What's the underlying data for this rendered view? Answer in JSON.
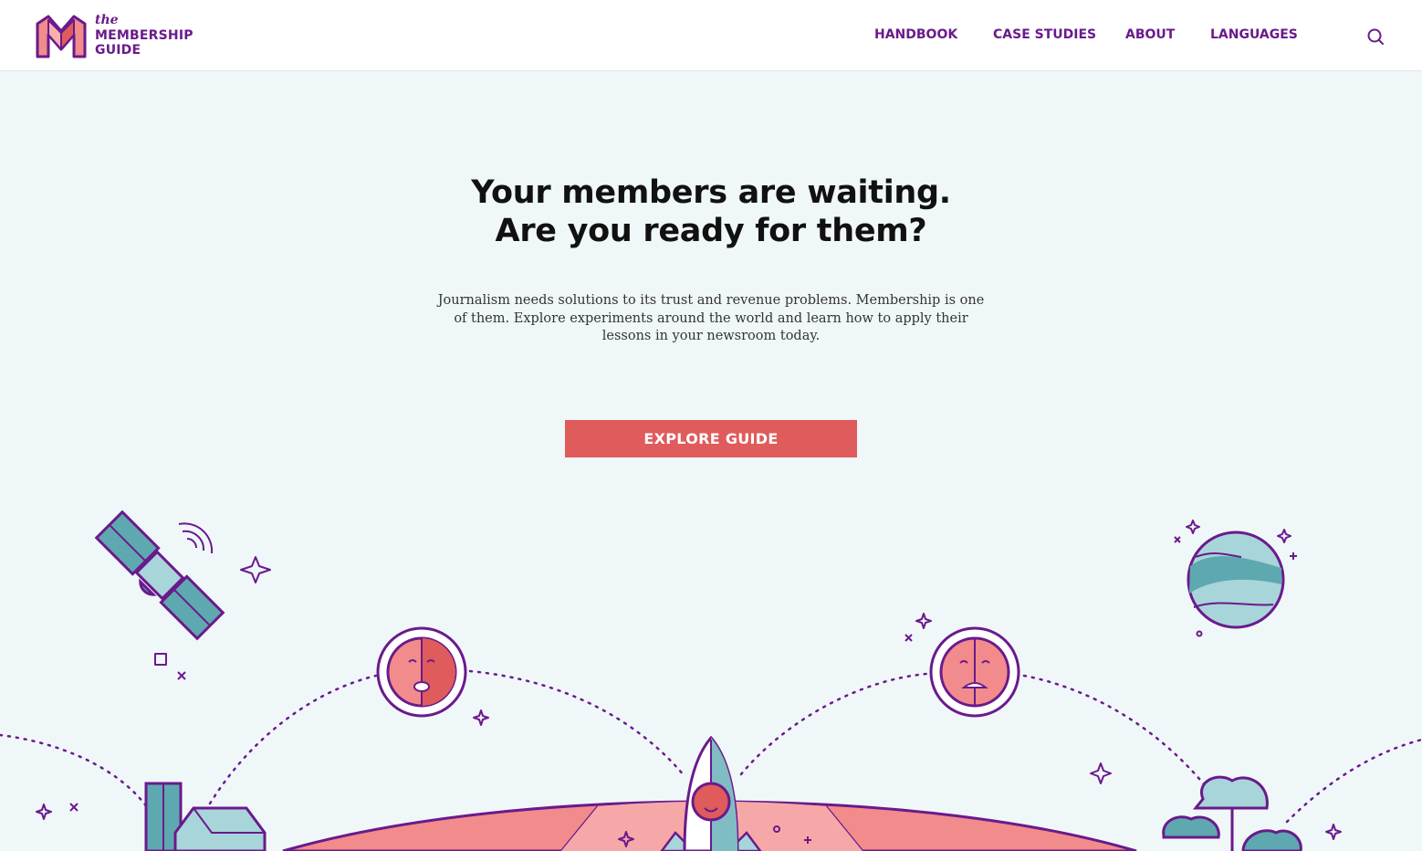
{
  "brand": {
    "the": "the",
    "line1": "MEMBERSHIP",
    "line2": "GUIDE",
    "purple": "#6a1a8c",
    "coral": "#e05b5b",
    "teal": "#5ea9b0"
  },
  "nav": {
    "items": [
      {
        "label": "HANDBOOK"
      },
      {
        "label": "CASE STUDIES"
      },
      {
        "label": "ABOUT"
      },
      {
        "label": "LANGUAGES"
      }
    ],
    "search_icon": "search-icon"
  },
  "hero": {
    "headline_line1": "Your members are waiting.",
    "headline_line2": "Are you ready for them?",
    "intro": "Journalism needs solutions to its trust and revenue problems. Membership is one of them. Explore experiments around the world and learn how to apply their lessons in your newsroom today.",
    "cta_label": "EXPLORE GUIDE"
  },
  "illustration": {
    "elements": [
      "satellite",
      "planet",
      "rocket",
      "face-left",
      "face-right",
      "buildings",
      "trees",
      "globe-horizon",
      "sparkles"
    ]
  }
}
